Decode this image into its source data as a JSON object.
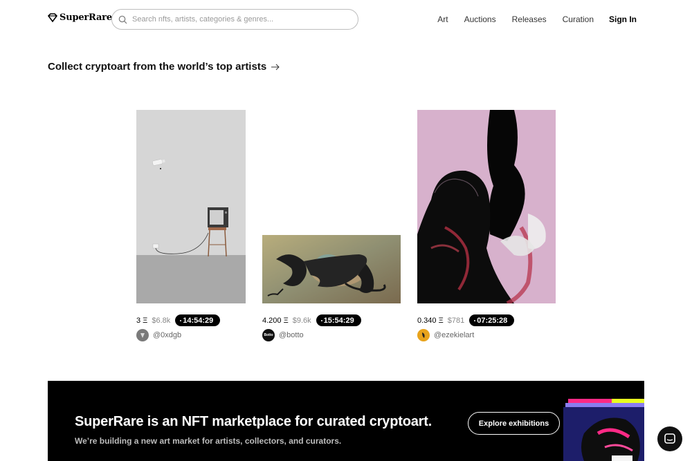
{
  "header": {
    "logo_text": "SuperRare",
    "search_placeholder": "Search nfts, artists, categories & genres...",
    "nav": [
      "Art",
      "Auctions",
      "Releases",
      "Curation"
    ],
    "sign_in": "Sign In"
  },
  "headline": {
    "text": "Collect cryptoart from the world’s top artists",
    "arrow_icon": "arrow-right-icon"
  },
  "cards": [
    {
      "price": "3 Ξ",
      "usd": "$6.8k",
      "timer": "14:54:29",
      "artist": "@0xdgb",
      "avatar_color": "#7a7a7a"
    },
    {
      "price": "4.200 Ξ",
      "usd": "$9.6k",
      "timer": "15:54:29",
      "artist": "@botto",
      "avatar_text": "Botto",
      "avatar_color": "#111111"
    },
    {
      "price": "0.340 Ξ",
      "usd": "$781",
      "timer": "07:25:28",
      "artist": "@ezekielart",
      "avatar_color": "#e8a31c"
    }
  ],
  "banner": {
    "title": "SuperRare is an NFT marketplace for curated cryptoart.",
    "subtitle": "We’re building a new art market for artists, collectors, and curators.",
    "button": "Explore exhibitions"
  },
  "colors": {
    "accent_pink": "#ff2a86",
    "accent_yellow": "#e9ff1f",
    "banner_bg": "#000000"
  },
  "chat_icon": "chat-bubble-icon"
}
